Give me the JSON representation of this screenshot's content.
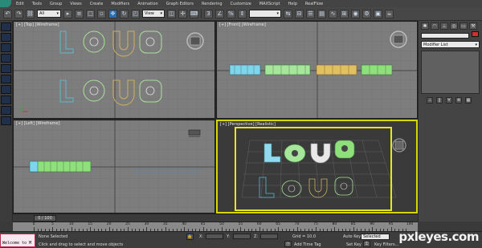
{
  "menu": {
    "items": [
      "Edit",
      "Tools",
      "Group",
      "Views",
      "Create",
      "Modifiers",
      "Animation",
      "Graph Editors",
      "Rendering",
      "Customize",
      "MAXScript",
      "Help",
      "RealFlow"
    ]
  },
  "toolbar": {
    "filter_value": "All",
    "view_value": "View"
  },
  "viewports": {
    "top_label": "[+] [Top] [Wireframe]",
    "front_label": "[+] [Front] [Wireframe]",
    "left_label": "[+] [Left] [Wireframe]",
    "perspective_label": "[+] [Perspective] [Realistic]"
  },
  "command_panel": {
    "modifier_list": "Modifier List"
  },
  "timeline": {
    "slider_text": "0 / 100",
    "ticks": [
      "0",
      "5",
      "10",
      "15",
      "20",
      "25",
      "30",
      "35",
      "40",
      "45",
      "50",
      "55",
      "60",
      "65",
      "70",
      "75",
      "80",
      "85",
      "90",
      "95",
      "100"
    ]
  },
  "status": {
    "listener_text": "Welcome to M",
    "selection": "None Selected",
    "prompt": "Click and drag to select and move objects",
    "x_label": "X:",
    "y_label": "Y:",
    "z_label": "Z:",
    "grid": "Grid = 10.0",
    "add_time_tag": "Add Time Tag",
    "auto_key": "Auto Key",
    "set_key": "Set Key",
    "selected_dropdown": "Selected",
    "key_filters": "Key Filters..."
  },
  "watermark": "pxleyes.com",
  "colors": {
    "active_viewport_border": "#d8d800",
    "logo": "#2a8a7a",
    "letter_cyan": "#7fd6ea",
    "letter_green": "#8ee07a",
    "letter_yellow": "#e0c060",
    "letter_white": "#e8e8e8"
  }
}
